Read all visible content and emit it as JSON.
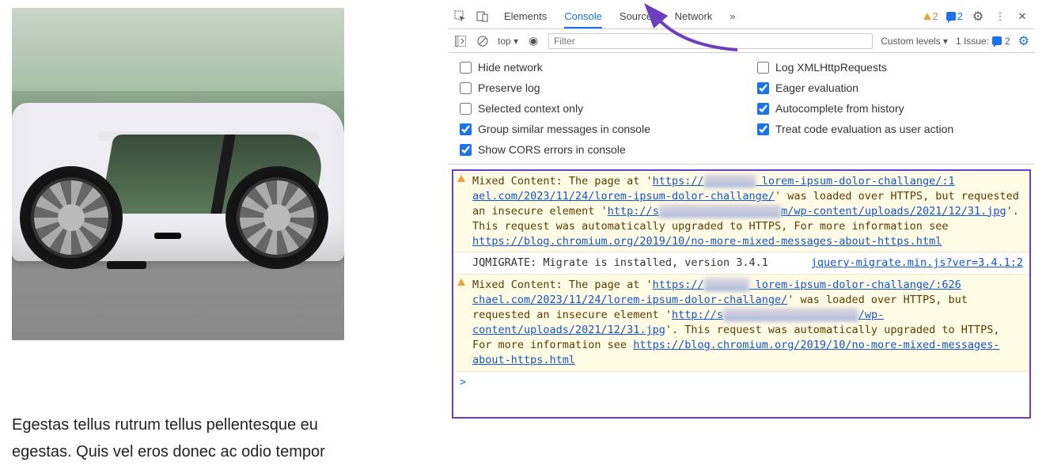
{
  "page": {
    "body_text": "Egestas tellus rutrum tellus pellentesque eu egestas. Quis vel eros donec ac odio tempor"
  },
  "devtools": {
    "tabs": [
      "Elements",
      "Console",
      "Sources",
      "Network"
    ],
    "active_tab": "Console",
    "more": "»",
    "warn_count": "2",
    "msg_count": "2",
    "toolbar": {
      "context": "top",
      "filter_placeholder": "Filter",
      "custom_levels": "Custom levels",
      "issues_label": "1 Issue:",
      "issues_count": "2"
    },
    "settings": {
      "left": [
        {
          "label": "Hide network",
          "checked": false
        },
        {
          "label": "Preserve log",
          "checked": false
        },
        {
          "label": "Selected context only",
          "checked": false
        },
        {
          "label": "Group similar messages in console",
          "checked": true
        },
        {
          "label": "Show CORS errors in console",
          "checked": true
        }
      ],
      "right": [
        {
          "label": "Log XMLHttpRequests",
          "checked": false
        },
        {
          "label": "Eager evaluation",
          "checked": true
        },
        {
          "label": "Autocomplete from history",
          "checked": true
        },
        {
          "label": "Treat code evaluation as user action",
          "checked": true
        }
      ]
    },
    "console": {
      "warn1": {
        "pre": "Mixed Content: The page at '",
        "link1a": "https://",
        "blur1": "xxxxxxxx",
        "link1b": " lorem-ipsum-dolor-challange/:1",
        "line2a": "ael.com/2023/11/24/lorem-ipsum-dolor-challange/",
        "line2b": "' was loaded over HTTPS, but requested an insecure element '",
        "link2a": "http://s",
        "blur2": "xxxxxxxxxxxxxxxxxxx",
        "link2b": "m/wp-content/uploads/2021/12/31.jpg",
        "line3": "'. This request was automatically upgraded to HTTPS, For more information see ",
        "link3": "https://blog.chromium.org/2019/10/no-more-mixed-messages-about-https.html"
      },
      "info": {
        "text": "JQMIGRATE: Migrate is installed, version 3.4.1",
        "src": "jquery-migrate.min.js?ver=3.4.1:2"
      },
      "warn2": {
        "pre": "Mixed Content: The page at '",
        "link1a": "https://",
        "blur1": "xxxxxxx",
        "link1b": " lorem-ipsum-dolor-challange/:626",
        "line2a": "chael.com/2023/11/24/lorem-ipsum-dolor-challange/",
        "line2b": "' was loaded over HTTPS, but requested an insecure element '",
        "link2a": "http://s",
        "blur2": "xxxxxxxxxxxxxxxxxxxxx",
        "link2b": "/wp-content/uploads/2021/12/31.jpg",
        "line3": "'. This request was automatically upgraded to HTTPS, For more information see ",
        "link3": "https://blog.chromium.org/2019/10/no-more-mixed-messages-about-https.html"
      },
      "prompt": ">"
    }
  }
}
